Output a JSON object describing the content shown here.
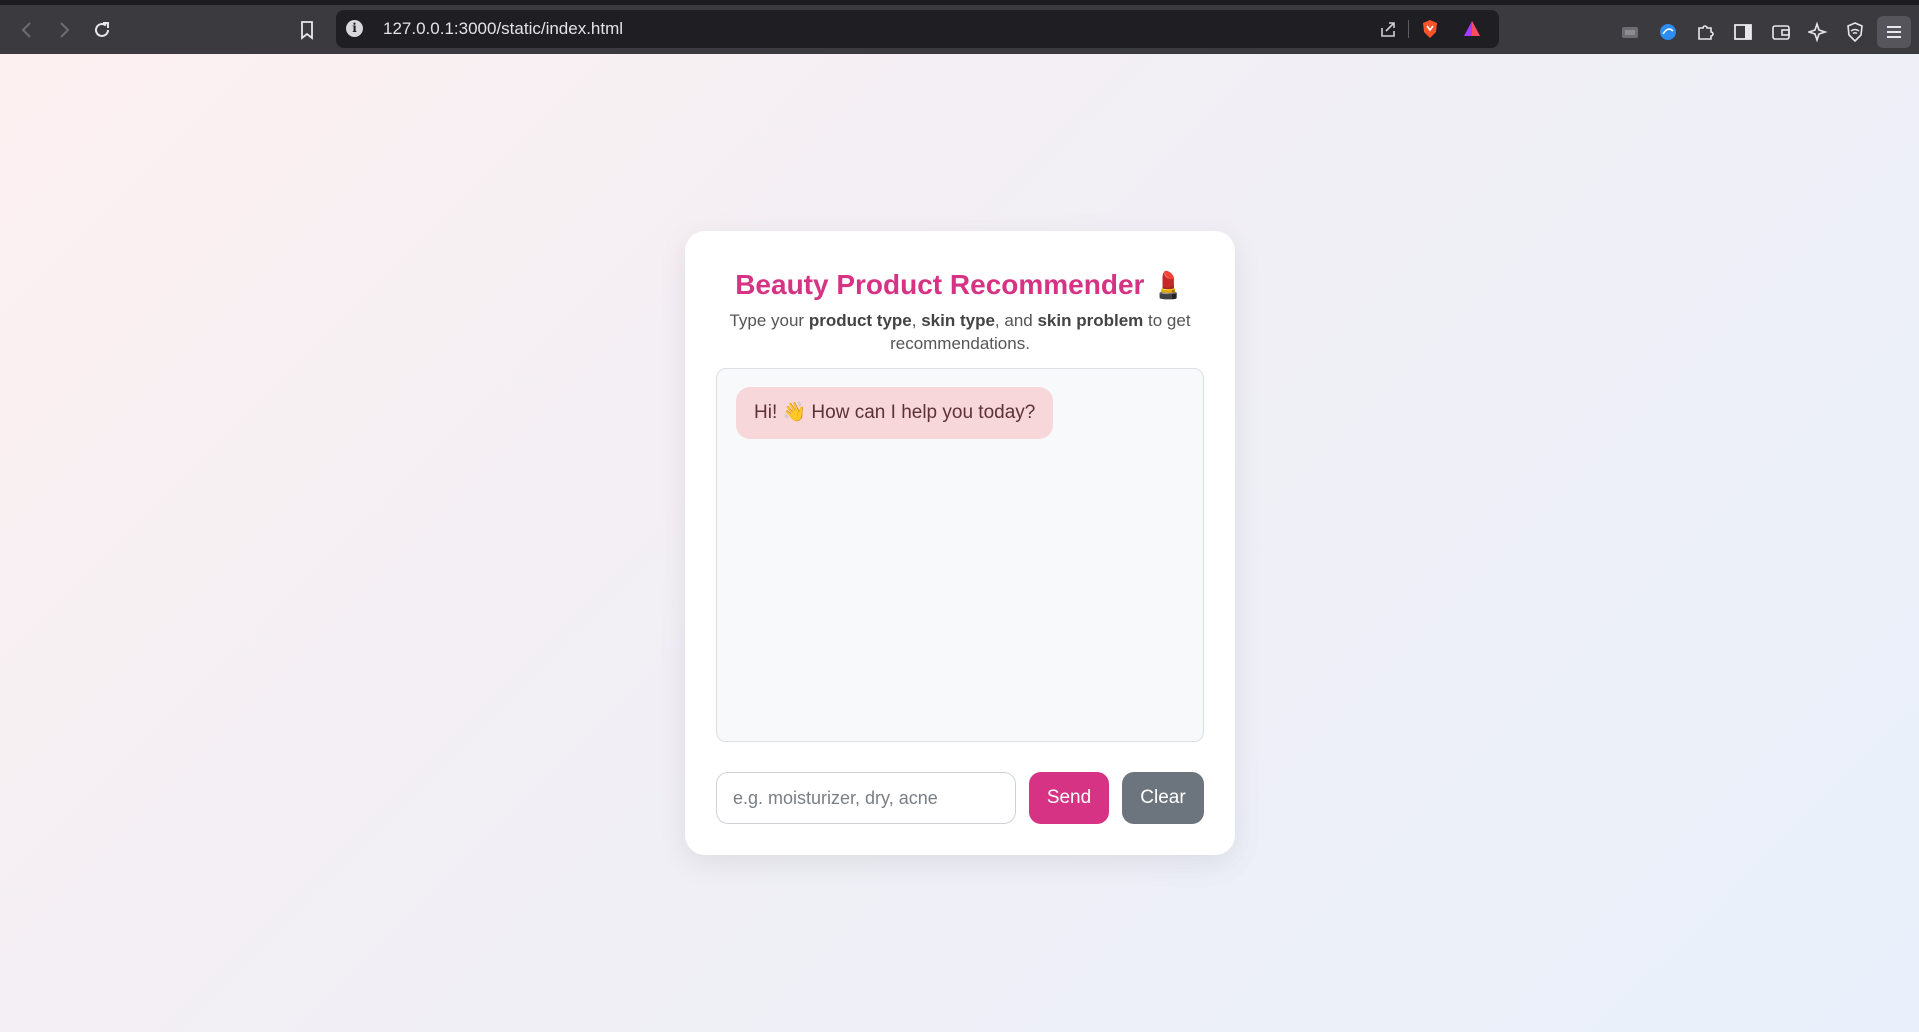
{
  "browser": {
    "url": "127.0.0.1:3000/static/index.html",
    "info_symbol": "i"
  },
  "page": {
    "title": "Beauty Product Recommender",
    "title_emoji": "💄",
    "subtitle": {
      "part1": "Type your ",
      "bold1": "product type",
      "part2": ", ",
      "bold2": "skin type",
      "part3": ", and ",
      "bold3": "skin problem",
      "part4": " to get recommendations."
    },
    "messages": [
      {
        "sender": "bot",
        "text": "Hi! 👋 How can I help you today?"
      }
    ],
    "input": {
      "placeholder": "e.g. moisturizer, dry, acne",
      "value": ""
    },
    "send_label": "Send",
    "clear_label": "Clear"
  },
  "colors": {
    "accent": "#d63384",
    "clear_button": "#6c757d",
    "bot_bubble": "#f8d7da"
  }
}
